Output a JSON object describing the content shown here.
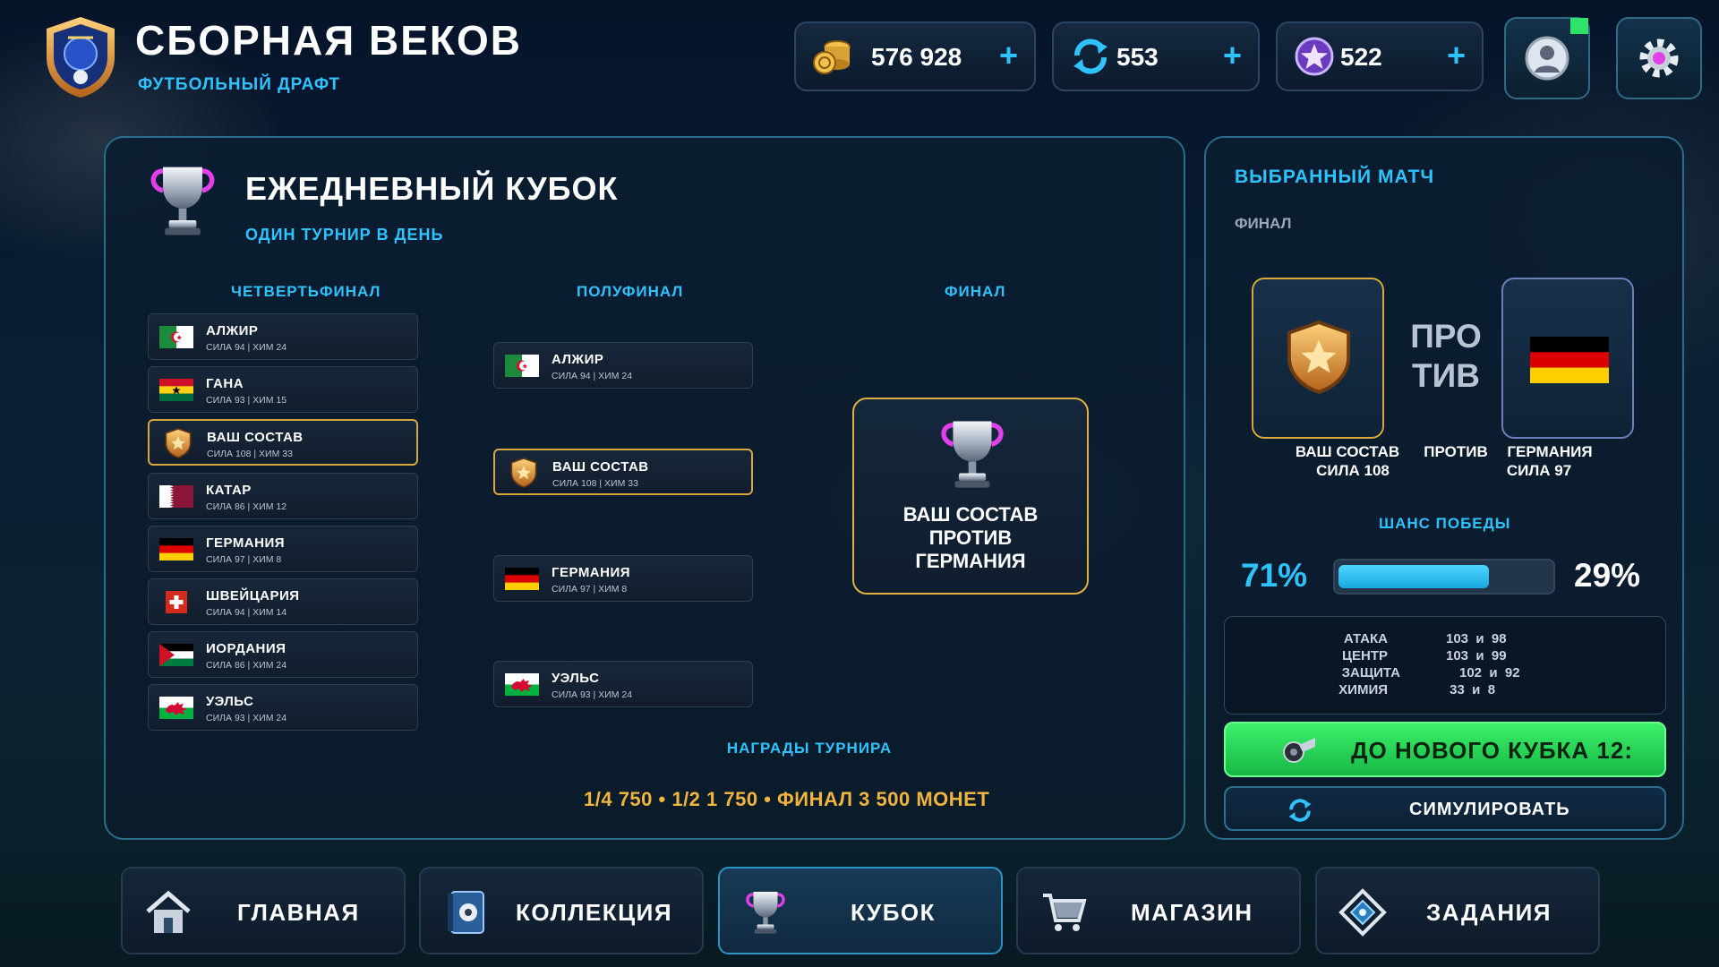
{
  "header": {
    "title": "СБОРНАЯ ВЕКОВ",
    "subtitle": "ФУТБОЛЬНЫЙ ДРАФТ",
    "currencies": [
      {
        "icon": "coins-icon",
        "value": "576 928",
        "plus": "+"
      },
      {
        "icon": "refresh-token-icon",
        "value": "553",
        "plus": "+"
      },
      {
        "icon": "star-gem-icon",
        "value": "522",
        "plus": "+"
      }
    ]
  },
  "cup": {
    "title": "ЕЖЕДНЕВНЫЙ КУБОК",
    "subtitle": "ОДИН ТУРНИР В ДЕНЬ",
    "rounds": {
      "quarter": "ЧЕТВЕРТЬФИНАЛ",
      "semi": "ПОЛУФИНАЛ",
      "final": "ФИНАЛ"
    },
    "quarterfinal": [
      {
        "flag": "algeria",
        "name": "АЛЖИР",
        "stats": "СИЛА 94 | ХИМ 24"
      },
      {
        "flag": "ghana",
        "name": "ГАНА",
        "stats": "СИЛА 93 | ХИМ 15"
      },
      {
        "flag": "shield",
        "name": "ВАШ СОСТАВ",
        "stats": "СИЛА 108 | ХИМ 33"
      },
      {
        "flag": "qatar",
        "name": "КАТАР",
        "stats": "СИЛА 86 | ХИМ 12"
      },
      {
        "flag": "germany",
        "name": "ГЕРМАНИЯ",
        "stats": "СИЛА 97 | ХИМ 8"
      },
      {
        "flag": "switzerland",
        "name": "ШВЕЙЦАРИЯ",
        "stats": "СИЛА 94 | ХИМ 14"
      },
      {
        "flag": "jordan",
        "name": "ИОРДАНИЯ",
        "stats": "СИЛА 86 | ХИМ 24"
      },
      {
        "flag": "wales",
        "name": "УЭЛЬС",
        "stats": "СИЛА 93 | ХИМ 24"
      }
    ],
    "semifinal": [
      {
        "flag": "algeria",
        "name": "АЛЖИР",
        "stats": "СИЛА 94 | ХИМ 24"
      },
      {
        "flag": "shield",
        "name": "ВАШ СОСТАВ",
        "stats": "СИЛА 108 | ХИМ 33"
      },
      {
        "flag": "germany",
        "name": "ГЕРМАНИЯ",
        "stats": "СИЛА 97 | ХИМ 8"
      },
      {
        "flag": "wales",
        "name": "УЭЛЬС",
        "stats": "СИЛА 93 | ХИМ 24"
      }
    ],
    "final_card": {
      "line1": "ВАШ СОСТАВ",
      "line2": "ПРОТИВ",
      "line3": "ГЕРМАНИЯ"
    },
    "rewards_title": "НАГРАДЫ ТУРНИРА",
    "rewards": "1/4 750  •  1/2 1 750  •  ФИНАЛ 3 500 МОНЕТ"
  },
  "match": {
    "title": "ВЫБРАННЫЙ МАТЧ",
    "round": "ФИНАЛ",
    "vs_line1": "ПРО",
    "vs_line2": "ТИВ",
    "team_a": {
      "name": "ВАШ СОСТАВ",
      "power": "СИЛА 108"
    },
    "vs_label": "ПРОТИВ",
    "team_b": {
      "name": "ГЕРМАНИЯ",
      "power": "СИЛА 97"
    },
    "chance_title": "ШАНС ПОБЕДЫ",
    "chance_a": "71%",
    "chance_b": "29%",
    "chance_fraction": 0.71,
    "stats": [
      {
        "label": "АТАКА",
        "nums": "103  и  98"
      },
      {
        "label": "ЦЕНТР",
        "nums": "103  и  99"
      },
      {
        "label": "ЗАЩИТА",
        "nums": "102  и  92"
      },
      {
        "label": "ХИМИЯ",
        "nums": " 33  и  8"
      }
    ],
    "timer_button": "ДО НОВОГО КУБКА 12:",
    "simulate_button": "СИМУЛИРОВАТЬ"
  },
  "nav": [
    {
      "icon": "home-icon",
      "label": "ГЛАВНАЯ"
    },
    {
      "icon": "collection-book-icon",
      "label": "КОЛЛЕКЦИЯ"
    },
    {
      "icon": "trophy-icon",
      "label": "КУБОК"
    },
    {
      "icon": "cart-icon",
      "label": "МАГАЗИН"
    },
    {
      "icon": "quest-diamond-icon",
      "label": "ЗАДАНИЯ"
    }
  ],
  "colors": {
    "accent": "#2ec3ff",
    "gold": "#f1b53d",
    "green": "#2ee26a"
  }
}
